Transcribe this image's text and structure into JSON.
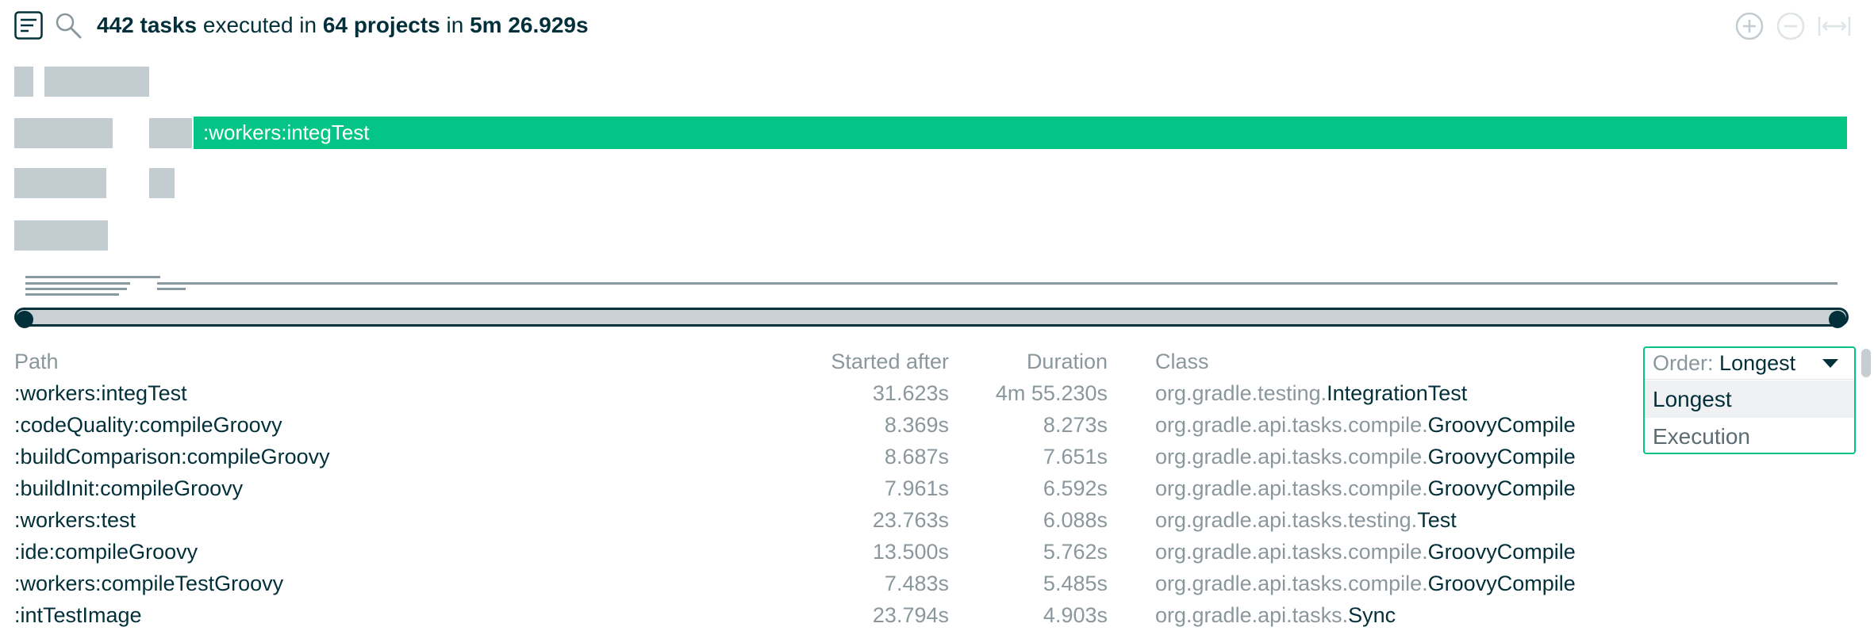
{
  "header": {
    "task_count": "442 tasks",
    "executed_text": "executed in",
    "project_count": "64 projects",
    "in_text": "in",
    "total_time": "5m 26.929s"
  },
  "timeline": {
    "highlighted_task": ":workers:integTest",
    "highlight_color": "#05c586"
  },
  "table": {
    "columns": {
      "path": "Path",
      "started_after": "Started after",
      "duration": "Duration",
      "class": "Class"
    },
    "rows": [
      {
        "path": ":workers:integTest",
        "started_after": "31.623s",
        "duration": "4m 55.230s",
        "class_package": "org.gradle.testing.",
        "class_name": "IntegrationTest"
      },
      {
        "path": ":codeQuality:compileGroovy",
        "started_after": "8.369s",
        "duration": "8.273s",
        "class_package": "org.gradle.api.tasks.compile.",
        "class_name": "GroovyCompile"
      },
      {
        "path": ":buildComparison:compileGroovy",
        "started_after": "8.687s",
        "duration": "7.651s",
        "class_package": "org.gradle.api.tasks.compile.",
        "class_name": "GroovyCompile"
      },
      {
        "path": ":buildInit:compileGroovy",
        "started_after": "7.961s",
        "duration": "6.592s",
        "class_package": "org.gradle.api.tasks.compile.",
        "class_name": "GroovyCompile"
      },
      {
        "path": ":workers:test",
        "started_after": "23.763s",
        "duration": "6.088s",
        "class_package": "org.gradle.api.tasks.testing.",
        "class_name": "Test"
      },
      {
        "path": ":ide:compileGroovy",
        "started_after": "13.500s",
        "duration": "5.762s",
        "class_package": "org.gradle.api.tasks.compile.",
        "class_name": "GroovyCompile"
      },
      {
        "path": ":workers:compileTestGroovy",
        "started_after": "7.483s",
        "duration": "5.485s",
        "class_package": "org.gradle.api.tasks.compile.",
        "class_name": "GroovyCompile"
      },
      {
        "path": ":intTestImage",
        "started_after": "23.794s",
        "duration": "4.903s",
        "class_package": "org.gradle.api.tasks.",
        "class_name": "Sync"
      }
    ]
  },
  "order": {
    "prefix": "Order:",
    "selected": "Longest",
    "options": [
      "Longest",
      "Execution"
    ]
  },
  "colors": {
    "text_dark": "#02303a",
    "text_muted": "#8a979c",
    "accent_green": "#05c586",
    "block_gray": "#c3ccd0"
  },
  "icons": {
    "summary": "summary-list-icon",
    "search": "search-icon",
    "zoom_in": "zoom-in-icon",
    "zoom_out": "zoom-out-icon",
    "fit_width": "fit-width-icon"
  }
}
